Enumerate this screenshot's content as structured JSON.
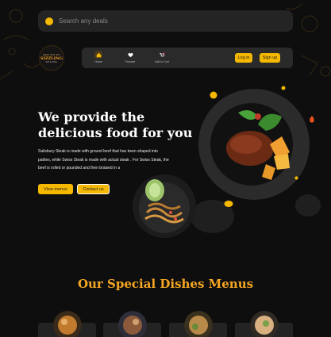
{
  "search": {
    "placeholder": "Search any deals"
  },
  "logo": {
    "line1": "DESI TAS SIS",
    "line2": "SIZZLING",
    "line3": "EAT & CHILL"
  },
  "nav": {
    "items": [
      {
        "label": "Home",
        "icon": "home-icon"
      },
      {
        "label": "Favorite",
        "icon": "heart-icon"
      },
      {
        "label": "Add to Cart",
        "icon": "cart-icon"
      }
    ],
    "login_label": "Log in",
    "signup_label": "Sign up"
  },
  "hero": {
    "title_line1": "We provide the",
    "title_line2": "delicious food for you",
    "description": "Salisbury Steak is made with ground beef that has been shaped into patties, while Swiss Steak is made with actual steak . For Swiss Steak, the beef is rolled or pounded and then braised in a",
    "menus_button": "View menus",
    "contact_button": "Contact us"
  },
  "special": {
    "title": "Our Special Dishes Menus"
  },
  "colors": {
    "accent": "#f5b800",
    "title_orange": "#f5a623",
    "bg": "#0e0e0e"
  }
}
